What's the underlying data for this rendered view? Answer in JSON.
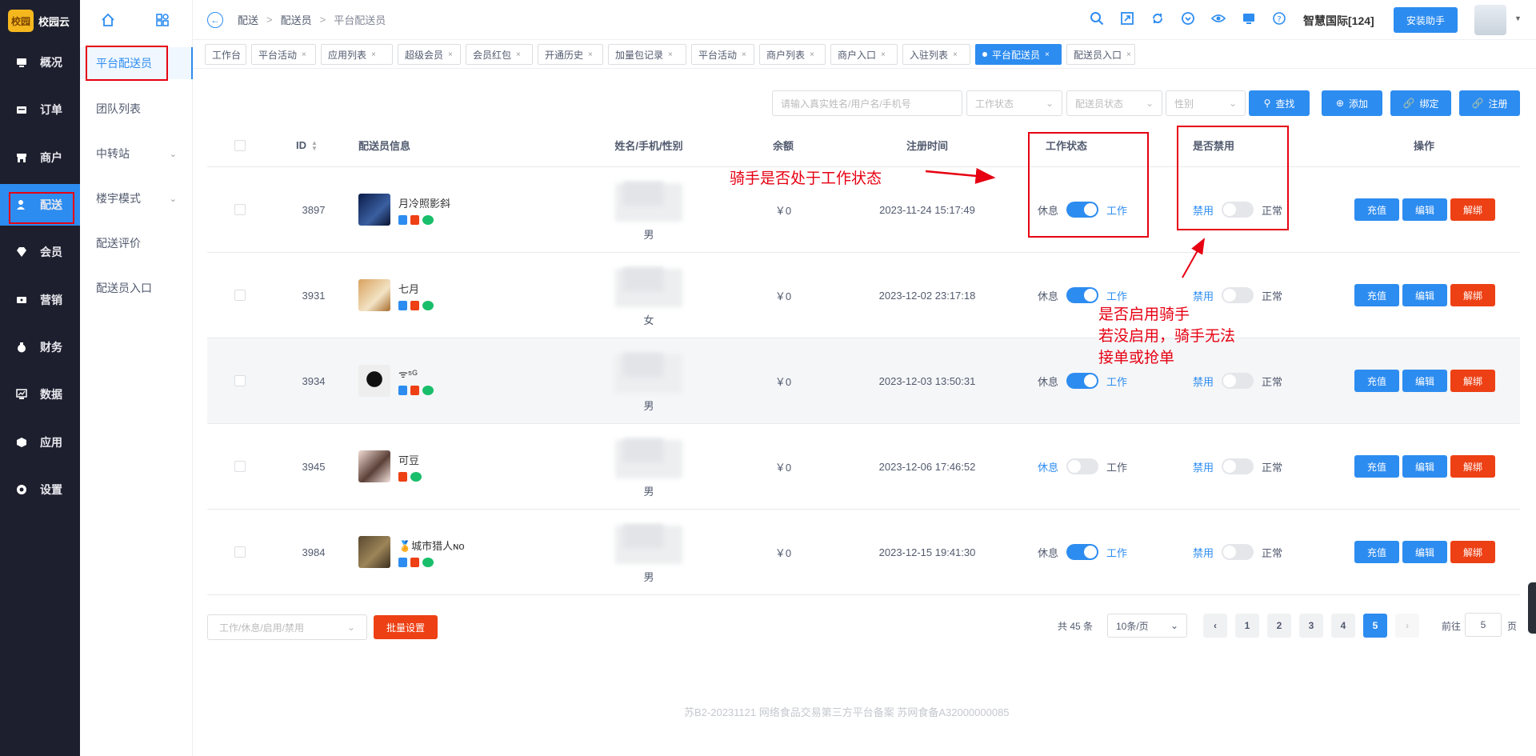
{
  "brand": {
    "logo_text": "校园",
    "name": "校园云"
  },
  "nav": {
    "items": [
      {
        "label": "概况",
        "icon": "dashboard-icon"
      },
      {
        "label": "订单",
        "icon": "order-icon"
      },
      {
        "label": "商户",
        "icon": "store-icon"
      },
      {
        "label": "配送",
        "icon": "delivery-user-icon",
        "active": true
      },
      {
        "label": "会员",
        "icon": "diamond-icon"
      },
      {
        "label": "营销",
        "icon": "ticket-icon"
      },
      {
        "label": "财务",
        "icon": "money-bag-icon"
      },
      {
        "label": "数据",
        "icon": "monitor-chart-icon"
      },
      {
        "label": "应用",
        "icon": "cube-icon"
      },
      {
        "label": "设置",
        "icon": "gear-icon"
      }
    ]
  },
  "submenu": {
    "items": [
      {
        "label": "平台配送员",
        "active": true
      },
      {
        "label": "团队列表"
      },
      {
        "label": "中转站",
        "expandable": true
      },
      {
        "label": "楼宇模式",
        "expandable": true
      },
      {
        "label": "配送评价"
      },
      {
        "label": "配送员入口"
      }
    ]
  },
  "breadcrumb": {
    "items": [
      "配送",
      "配送员",
      "平台配送员"
    ]
  },
  "header": {
    "shop_name": "智慧国际[124]",
    "install_label": "安装助手"
  },
  "tabs": [
    {
      "label": "工作台",
      "closable": false
    },
    {
      "label": "平台活动",
      "closable": true
    },
    {
      "label": "应用列表",
      "closable": true
    },
    {
      "label": "超级会员",
      "closable": true
    },
    {
      "label": "会员红包",
      "closable": true
    },
    {
      "label": "开通历史",
      "closable": true
    },
    {
      "label": "加量包记录",
      "closable": true
    },
    {
      "label": "平台活动",
      "closable": true
    },
    {
      "label": "商户列表",
      "closable": true
    },
    {
      "label": "商户入口",
      "closable": true
    },
    {
      "label": "入驻列表",
      "closable": true
    },
    {
      "label": "平台配送员",
      "closable": true,
      "active": true
    },
    {
      "label": "配送员入口",
      "closable": true
    }
  ],
  "tab_close": "×",
  "filters": {
    "search_placeholder": "请输入真实姓名/用户名/手机号",
    "work_status_placeholder": "工作状态",
    "courier_status_placeholder": "配送员状态",
    "gender_placeholder": "性别",
    "search_btn": "查找",
    "add_btn": "添加",
    "bind_btn": "绑定",
    "register_btn": "注册"
  },
  "table": {
    "columns": [
      "ID",
      "配送员信息",
      "姓名/手机/性别",
      "余额",
      "注册时间",
      "工作状态",
      "是否禁用",
      "操作"
    ],
    "switch_labels": {
      "rest": "休息",
      "work": "工作",
      "disable": "禁用",
      "normal": "正常"
    },
    "action_labels": {
      "recharge": "充值",
      "edit": "编辑",
      "unbind": "解绑"
    },
    "rows": [
      {
        "id": "3897",
        "name": "月冷照影斜",
        "gender": "男",
        "balance": "￥0",
        "reg_time": "2023-11-24 15:17:49",
        "working": true,
        "disabled": false,
        "badges": [
          "blue",
          "red",
          "green"
        ]
      },
      {
        "id": "3931",
        "name": "七月",
        "gender": "女",
        "balance": "￥0",
        "reg_time": "2023-12-02 23:17:18",
        "working": true,
        "disabled": false,
        "badges": [
          "blue",
          "red",
          "green"
        ]
      },
      {
        "id": "3934",
        "name": "ᯤ⁵ᴳ",
        "gender": "男",
        "balance": "￥0",
        "reg_time": "2023-12-03 13:50:31",
        "working": true,
        "disabled": false,
        "badges": [
          "blue",
          "red",
          "green"
        ]
      },
      {
        "id": "3945",
        "name": "可豆",
        "gender": "男",
        "balance": "￥0",
        "reg_time": "2023-12-06 17:46:52",
        "working": false,
        "disabled": false,
        "badges": [
          "red",
          "green"
        ]
      },
      {
        "id": "3984",
        "name": "🏅城市猎人ɴᴏ",
        "gender": "男",
        "balance": "￥0",
        "reg_time": "2023-12-15 19:41:30",
        "working": true,
        "disabled": false,
        "badges": [
          "blue",
          "red",
          "green"
        ]
      }
    ]
  },
  "bottom": {
    "batch_placeholder": "工作/休息/启用/禁用",
    "batch_btn": "批量设置",
    "total": "共 45 条",
    "page_size": "10条/页",
    "pages": [
      "1",
      "2",
      "3",
      "4",
      "5"
    ],
    "current_page": "5",
    "goto_label": "前往",
    "goto_value": "5",
    "page_label": "页"
  },
  "footer": "苏B2-20231121   网络食品交易第三方平台备案 苏网食备A32000000085",
  "annotations": {
    "work_status_note": "骑手是否处于工作状态",
    "disable_note_lines": [
      "是否启用骑手",
      "若没启用，骑手无法",
      "接单或抢单"
    ],
    "color": "#e60012"
  }
}
